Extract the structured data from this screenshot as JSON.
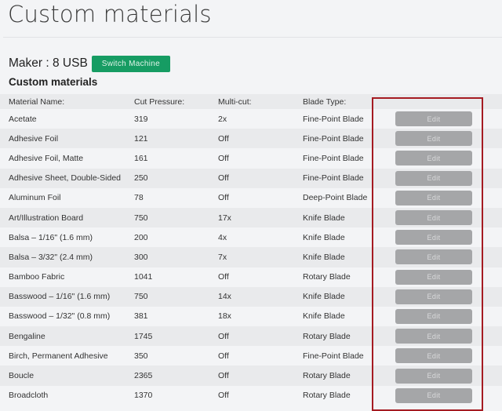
{
  "page": {
    "title": "Custom materials"
  },
  "maker": {
    "label": "Maker : 8 USB",
    "switch_button": "Switch Machine",
    "switch_button_color": "#169c63"
  },
  "section": {
    "title": "Custom materials"
  },
  "table": {
    "headers": [
      "Material Name:",
      "Cut Pressure:",
      "Multi-cut:",
      "Blade Type:",
      ""
    ],
    "edit_label": "Edit",
    "rows": [
      {
        "name": "Acetate",
        "pressure": "319",
        "multicut": "2x",
        "blade": "Fine-Point Blade",
        "action": "Edit"
      },
      {
        "name": "Adhesive Foil",
        "pressure": "121",
        "multicut": "Off",
        "blade": "Fine-Point Blade",
        "action": "Edit"
      },
      {
        "name": "Adhesive Foil, Matte",
        "pressure": "161",
        "multicut": "Off",
        "blade": "Fine-Point Blade",
        "action": "Edit"
      },
      {
        "name": "Adhesive Sheet, Double-Sided",
        "pressure": "250",
        "multicut": "Off",
        "blade": "Fine-Point Blade",
        "action": "Edit"
      },
      {
        "name": "Aluminum Foil",
        "pressure": "78",
        "multicut": "Off",
        "blade": "Deep-Point Blade",
        "action": "Edit"
      },
      {
        "name": "Art/Illustration Board",
        "pressure": "750",
        "multicut": "17x",
        "blade": "Knife Blade",
        "action": "Edit"
      },
      {
        "name": "Balsa – 1/16\" (1.6 mm)",
        "pressure": "200",
        "multicut": "4x",
        "blade": "Knife Blade",
        "action": "Edit"
      },
      {
        "name": "Balsa – 3/32\" (2.4 mm)",
        "pressure": "300",
        "multicut": "7x",
        "blade": "Knife Blade",
        "action": "Edit"
      },
      {
        "name": "Bamboo Fabric",
        "pressure": "1041",
        "multicut": "Off",
        "blade": "Rotary Blade",
        "action": "Edit"
      },
      {
        "name": "Basswood – 1/16\" (1.6 mm)",
        "pressure": "750",
        "multicut": "14x",
        "blade": "Knife Blade",
        "action": "Edit"
      },
      {
        "name": "Basswood – 1/32\" (0.8 mm)",
        "pressure": "381",
        "multicut": "18x",
        "blade": "Knife Blade",
        "action": "Edit"
      },
      {
        "name": "Bengaline",
        "pressure": "1745",
        "multicut": "Off",
        "blade": "Rotary Blade",
        "action": "Edit"
      },
      {
        "name": "Birch, Permanent Adhesive",
        "pressure": "350",
        "multicut": "Off",
        "blade": "Fine-Point Blade",
        "action": "Edit"
      },
      {
        "name": "Boucle",
        "pressure": "2365",
        "multicut": "Off",
        "blade": "Rotary Blade",
        "action": "Edit"
      },
      {
        "name": "Broadcloth",
        "pressure": "1370",
        "multicut": "Off",
        "blade": "Rotary Blade",
        "action": "Edit"
      }
    ]
  },
  "annotation": {
    "highlight_color": "#a51b22",
    "highlights": "edit-column"
  }
}
